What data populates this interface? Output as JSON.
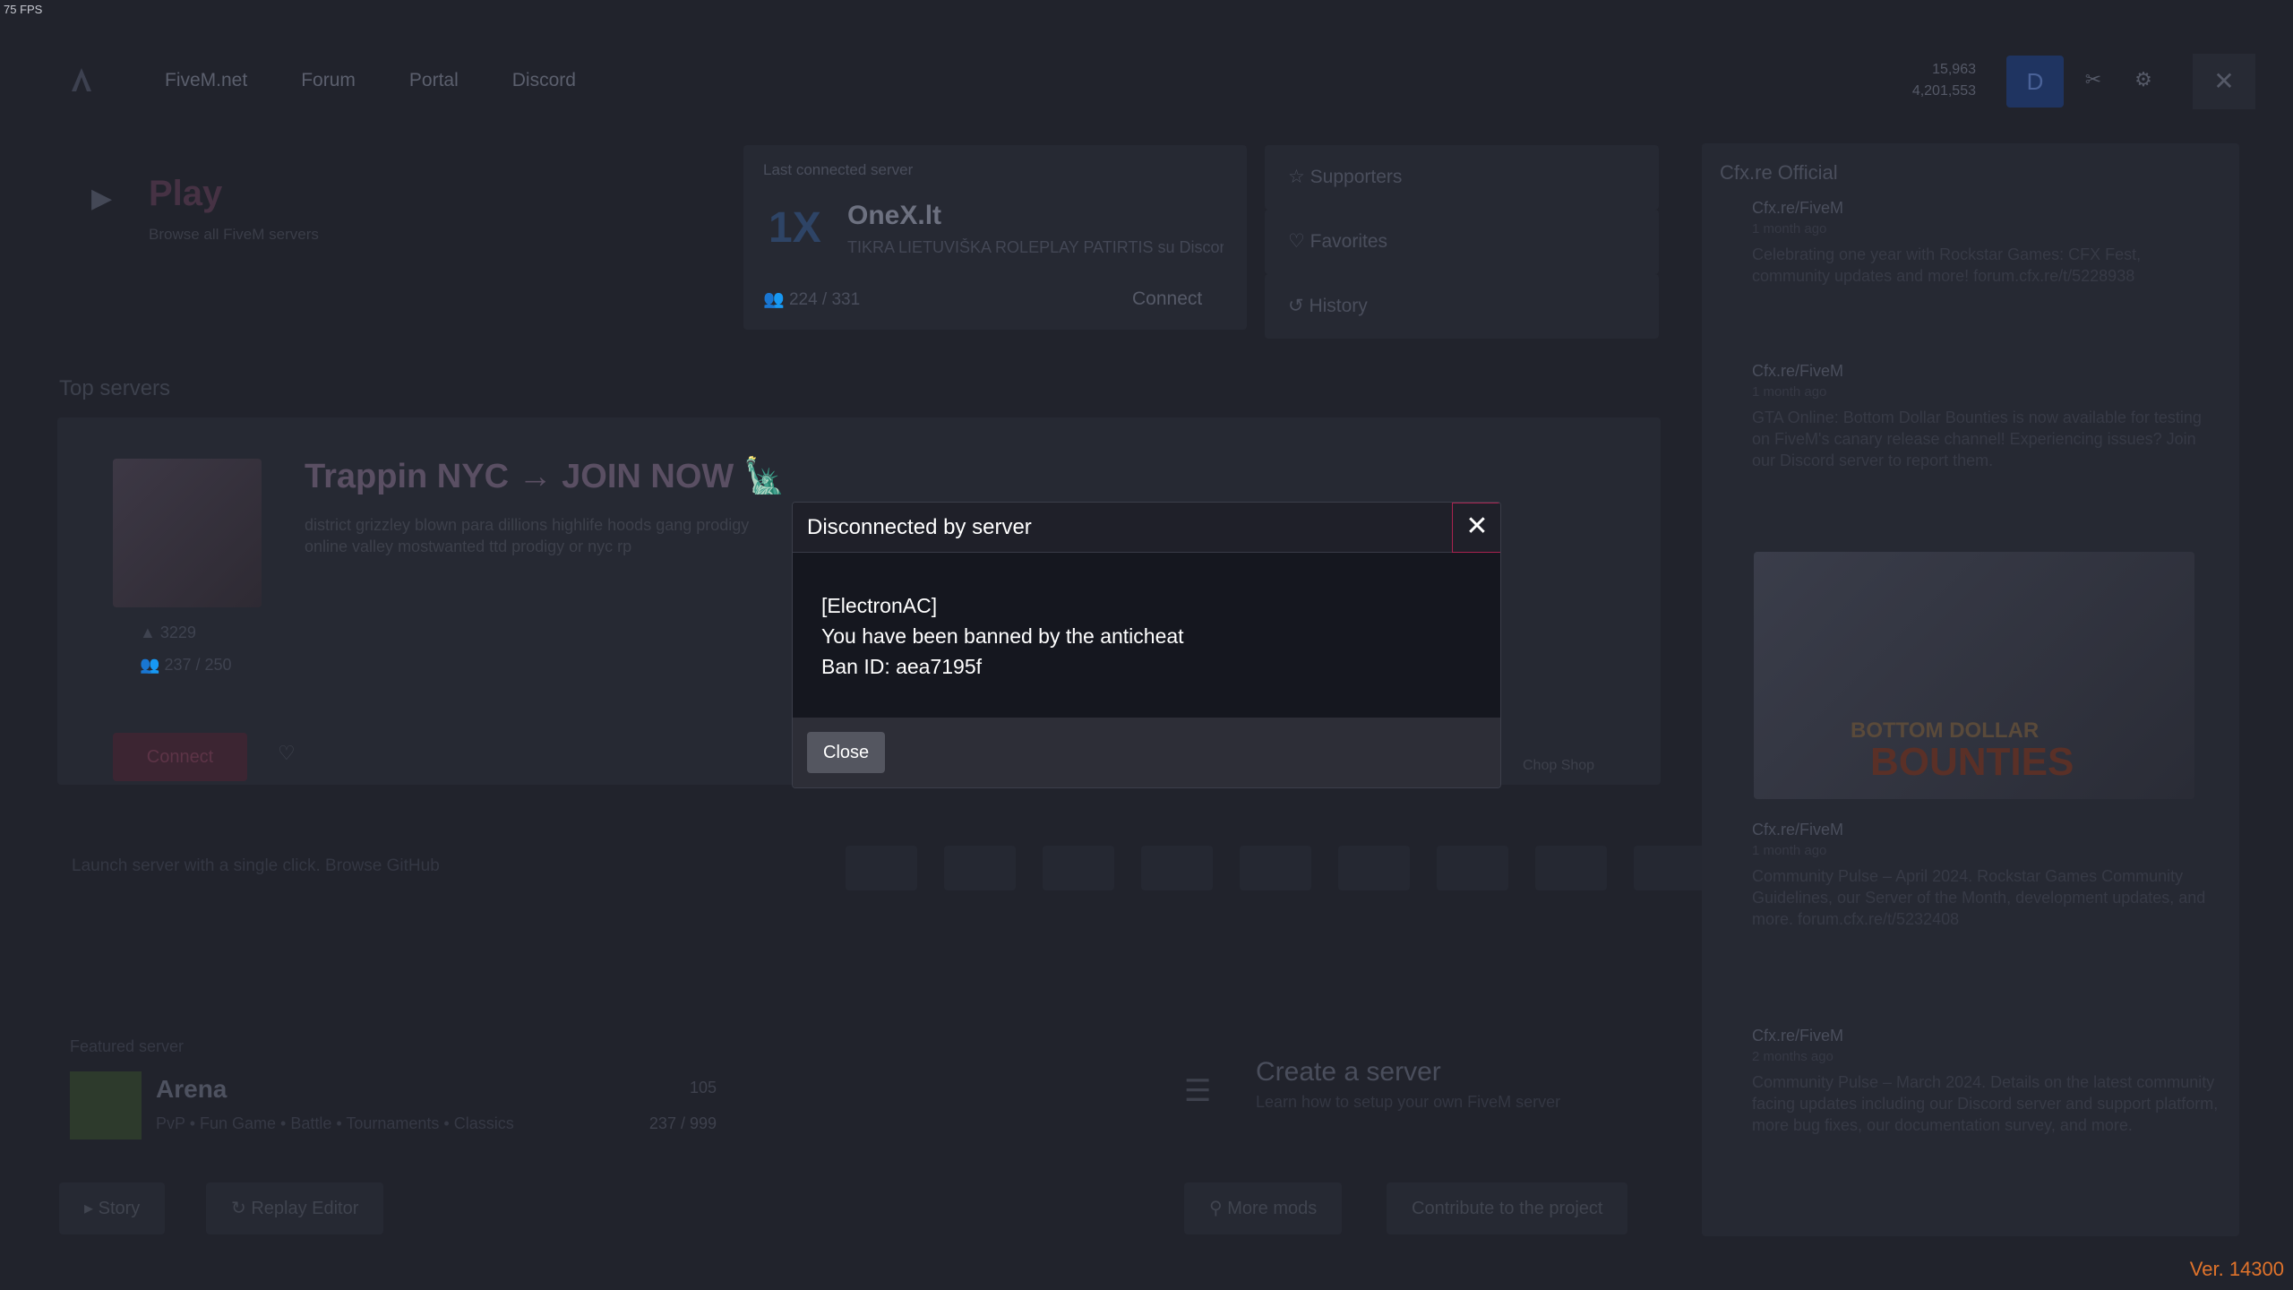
{
  "fps": "75 FPS",
  "nav": {
    "links": [
      "FiveM.net",
      "Forum",
      "Portal",
      "Discord"
    ],
    "stats": [
      "15,963",
      "4,201,553"
    ],
    "avatar": "D"
  },
  "play": {
    "title": "Play",
    "subtitle": "Browse all FiveM servers"
  },
  "last_server": {
    "label": "Last connected server",
    "name": "OneX.lt",
    "description": "TIKRA LIETUVIŠKA ROLEPLAY PATIRTIS su Discord",
    "players": "224 / 331",
    "connect": "Connect"
  },
  "side_menu": [
    "Supporters",
    "Favorites",
    "History"
  ],
  "top_servers": {
    "label": "Top servers",
    "title": "Trappin NYC → JOIN NOW 🗽",
    "description": "district grizzley blown para dillions highlife hoods gang prodigy online valley mostwanted ttd prodigy or nyc rp",
    "stat1": "3229",
    "stat2": "237 / 250",
    "connect": "Connect",
    "chop": "Chop Shop"
  },
  "launch_text": "Launch server with a single click. Browse GitHub",
  "featured": {
    "label": "Featured server",
    "name": "Arena",
    "tags": "PvP • Fun Game • Battle • Tournaments • Classics",
    "stat1": "105",
    "stat2": "237 / 999"
  },
  "create": {
    "title": "Create a server",
    "subtitle": "Learn how to setup your own FiveM server"
  },
  "bottom_buttons": [
    "Story",
    "Replay Editor",
    "More mods",
    "Contribute to the project"
  ],
  "news": {
    "title": "Cfx.re Official",
    "items": [
      {
        "author": "Cfx.re/FiveM",
        "date": "1 month ago",
        "body": "Celebrating one year with Rockstar Games: CFX Fest, community updates and more! forum.cfx.re/t/5228938"
      },
      {
        "author": "Cfx.re/FiveM",
        "date": "1 month ago",
        "body": "GTA Online: Bottom Dollar Bounties is now available for testing on FiveM's canary release channel! Experiencing issues? Join our Discord server to report them."
      },
      {
        "author": "Cfx.re/FiveM",
        "date": "1 month ago",
        "body": "Community Pulse – April 2024. Rockstar Games Community Guidelines, our Server of the Month, development updates, and more. forum.cfx.re/t/5232408"
      },
      {
        "author": "Cfx.re/FiveM",
        "date": "2 months ago",
        "body": "Community Pulse – March 2024. Details on the latest community facing updates including our Discord server and support platform, more bug fixes, our documentation survey, and more."
      }
    ],
    "image_text1": "BOTTOM DOLLAR",
    "image_text2": "BOUNTIES"
  },
  "modal": {
    "title": "Disconnected by server",
    "close_icon": "✕",
    "lines": [
      "[ElectronAC]",
      "You have been banned by the anticheat",
      "Ban ID: aea7195f"
    ],
    "close_button": "Close"
  },
  "version": "Ver. 14300",
  "colors": {
    "accent": "#e0732b",
    "close_border": "#a9224f"
  }
}
